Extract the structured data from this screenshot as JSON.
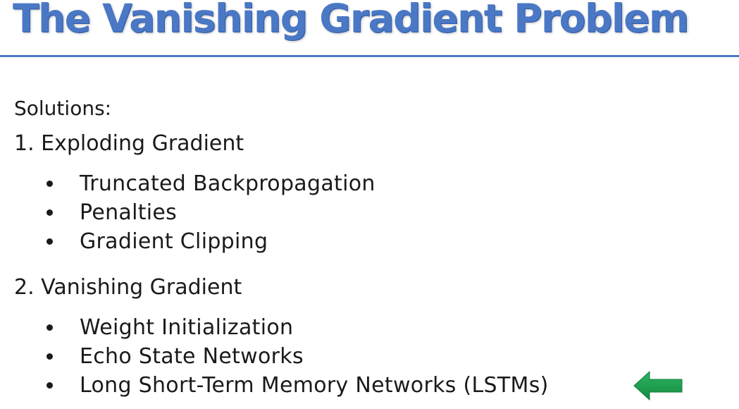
{
  "slide": {
    "title": "The Vanishing Gradient Problem",
    "intro": "Solutions:",
    "sections": [
      {
        "heading": "1. Exploding Gradient",
        "items": [
          "Truncated Backpropagation",
          "Penalties",
          "Gradient Clipping"
        ]
      },
      {
        "heading": "2. Vanishing Gradient",
        "items": [
          "Weight Initialization",
          "Echo State Networks",
          "Long Short-Term Memory Networks (LSTMs)"
        ]
      }
    ],
    "colors": {
      "title": "#4a78c5",
      "arrow": "#1e9e4f",
      "text": "#1a1a1a"
    },
    "highlight_icon": "left-arrow-icon"
  }
}
